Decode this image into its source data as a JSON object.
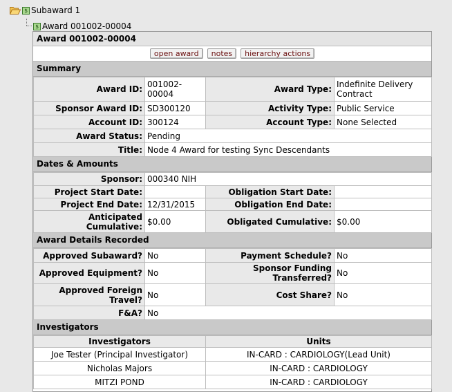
{
  "tree": {
    "root_label": "Subaward 1",
    "child_label": "Award 001002-00004"
  },
  "panel": {
    "title": "Award 001002-00004",
    "buttons": {
      "open_award": "open award",
      "notes": "notes",
      "hierarchy_actions": "hierarchy actions"
    }
  },
  "summary": {
    "heading": "Summary",
    "award_id_label": "Award ID:",
    "award_id": "001002-00004",
    "award_type_label": "Award Type:",
    "award_type": "Indefinite Delivery Contract",
    "sponsor_award_id_label": "Sponsor Award ID:",
    "sponsor_award_id": "SD300120",
    "activity_type_label": "Activity Type:",
    "activity_type": "Public Service",
    "account_id_label": "Account ID:",
    "account_id": "300124",
    "account_type_label": "Account Type:",
    "account_type": "None Selected",
    "award_status_label": "Award Status:",
    "award_status": "Pending",
    "title_label": "Title:",
    "title": "Node 4 Award for testing Sync Descendants"
  },
  "dates": {
    "heading": "Dates & Amounts",
    "sponsor_label": "Sponsor:",
    "sponsor": "000340 NIH",
    "project_start_label": "Project Start Date:",
    "project_start": "",
    "obligation_start_label": "Obligation Start Date:",
    "obligation_start": "",
    "project_end_label": "Project End Date:",
    "project_end": "12/31/2015",
    "obligation_end_label": "Obligation End Date:",
    "obligation_end": "",
    "anticipated_label": "Anticipated Cumulative:",
    "anticipated": "$0.00",
    "obligated_label": "Obligated Cumulative:",
    "obligated": "$0.00"
  },
  "details": {
    "heading": "Award Details Recorded",
    "approved_subaward_label": "Approved Subaward?",
    "approved_subaward": "No",
    "payment_schedule_label": "Payment Schedule?",
    "payment_schedule": "No",
    "approved_equipment_label": "Approved Equipment?",
    "approved_equipment": "No",
    "sponsor_funding_label": "Sponsor Funding Transferred?",
    "sponsor_funding": "No",
    "approved_foreign_label": "Approved Foreign Travel?",
    "approved_foreign": "No",
    "cost_share_label": "Cost Share?",
    "cost_share": "No",
    "fa_label": "F&A?",
    "fa": "No"
  },
  "investigators": {
    "heading": "Investigators",
    "col_investigators": "Investigators",
    "col_units": "Units",
    "rows": [
      {
        "name": "Joe Tester (Principal Investigator)",
        "unit": "IN-CARD : CARDIOLOGY(Lead Unit)"
      },
      {
        "name": "Nicholas Majors",
        "unit": "IN-CARD : CARDIOLOGY"
      },
      {
        "name": "MITZI POND",
        "unit": "IN-CARD : CARDIOLOGY"
      }
    ]
  }
}
